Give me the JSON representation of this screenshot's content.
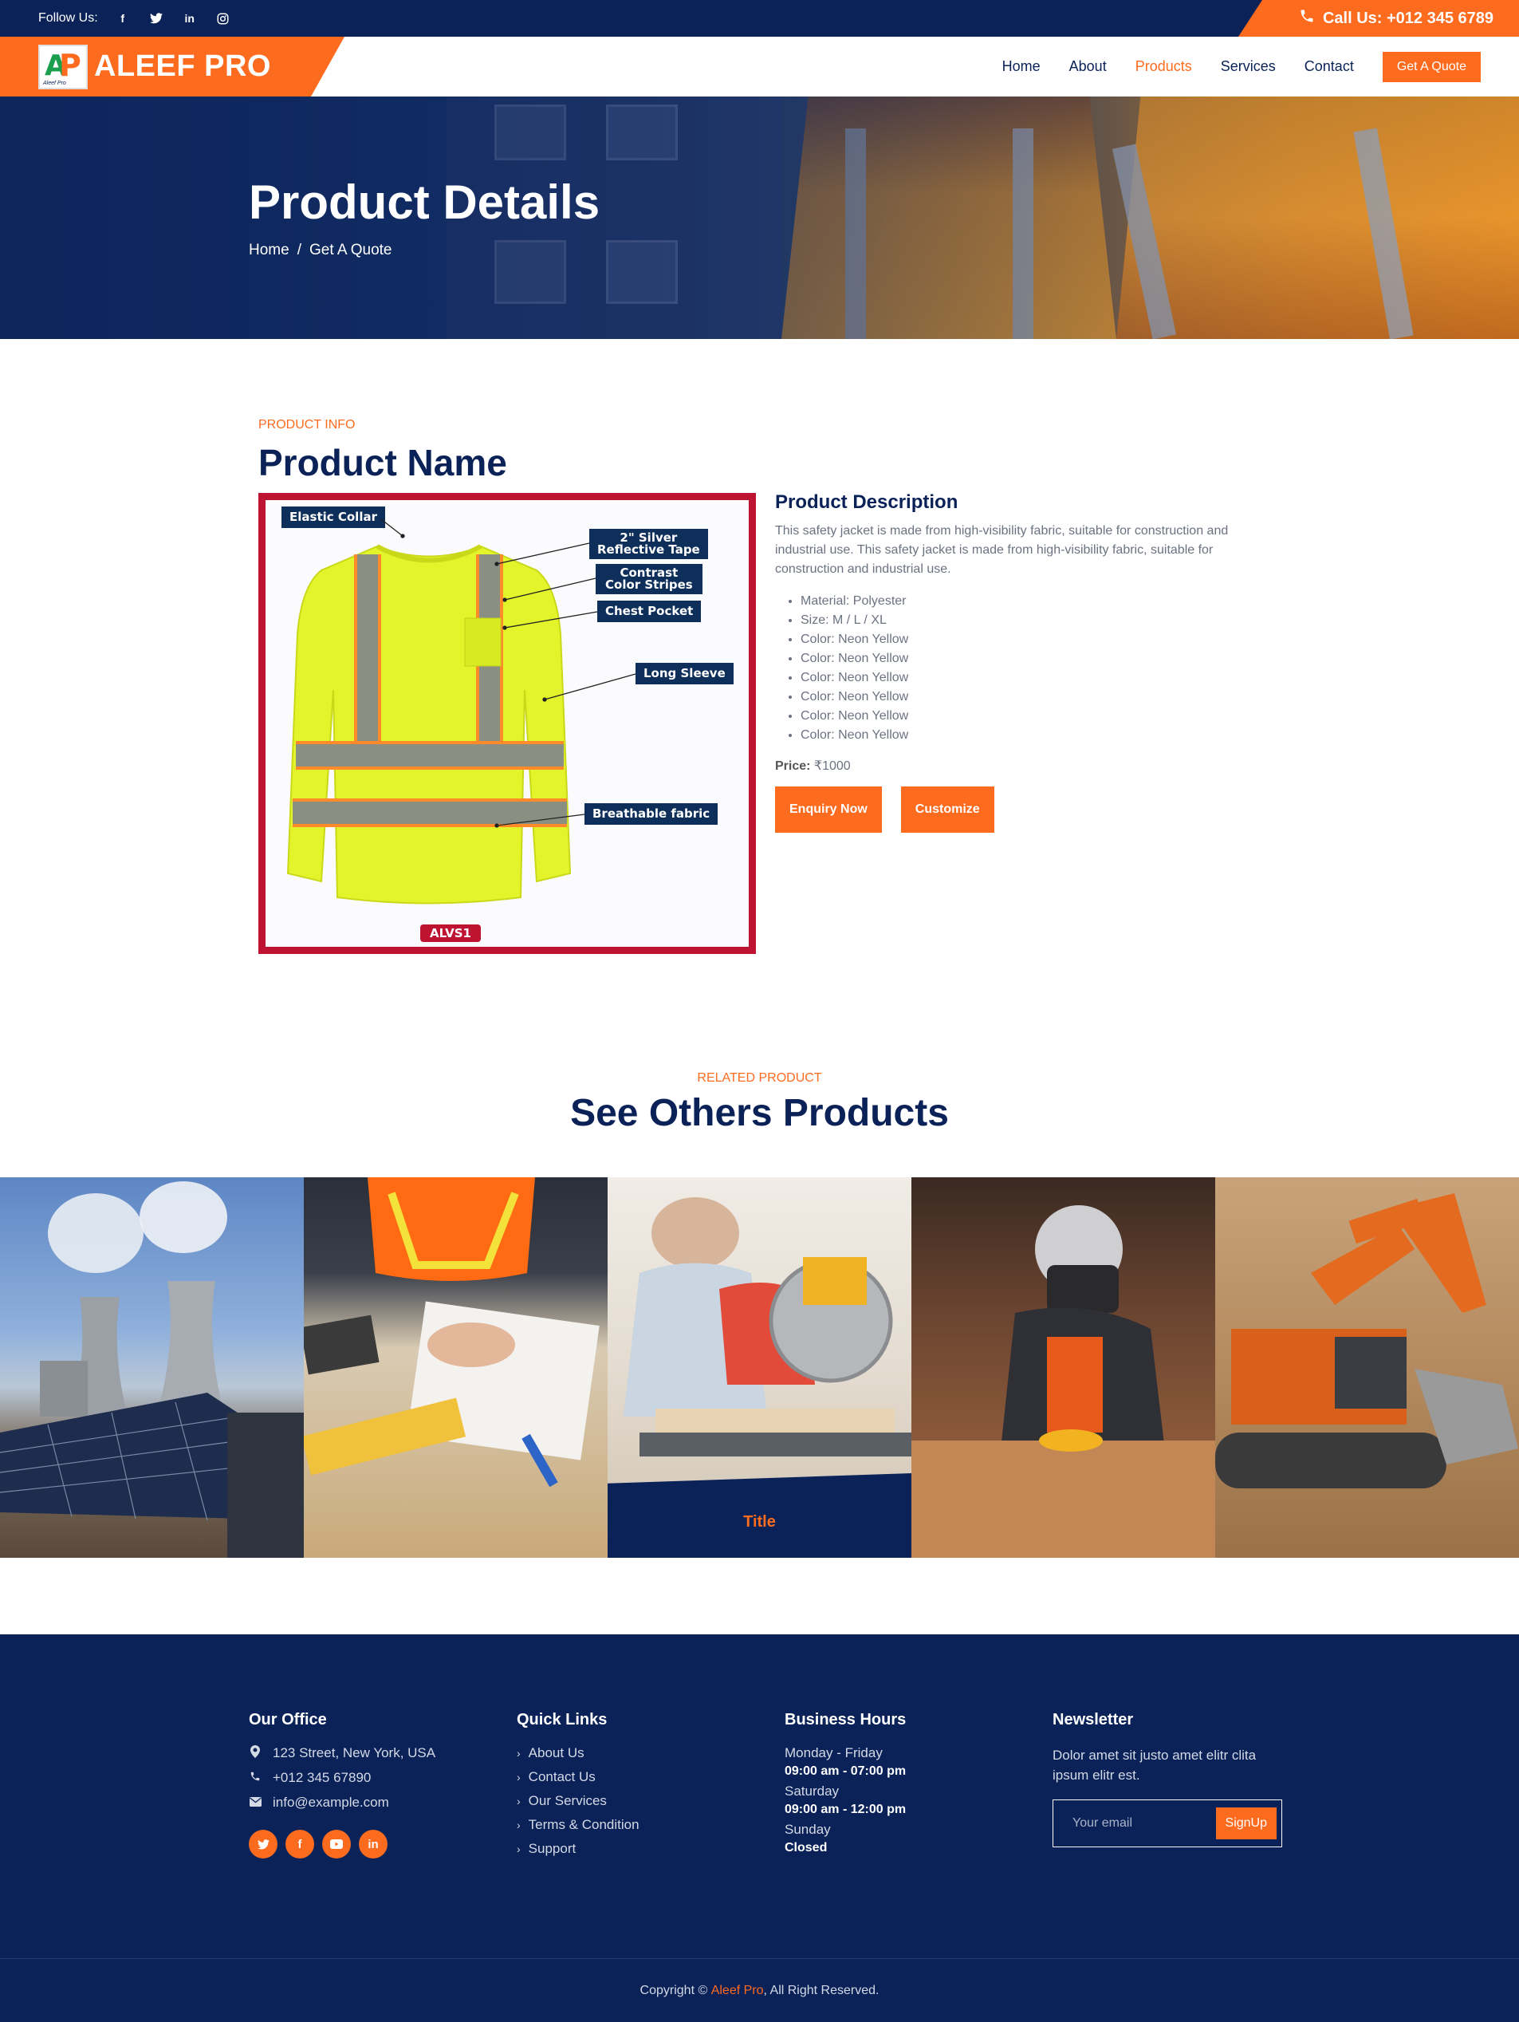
{
  "topbar": {
    "follow_label": "Follow Us:",
    "social_icons": [
      "facebook-icon",
      "twitter-icon",
      "linkedin-icon",
      "instagram-icon"
    ],
    "call_label": "Call Us: +012 345 6789"
  },
  "nav": {
    "brand": "ALEEF PRO",
    "logo_text": "Aleef Pro",
    "menu": [
      {
        "label": "Home",
        "active": false
      },
      {
        "label": "About",
        "active": false
      },
      {
        "label": "Products",
        "active": true
      },
      {
        "label": "Services",
        "active": false
      },
      {
        "label": "Contact",
        "active": false
      }
    ],
    "cta": "Get A Quote"
  },
  "hero": {
    "title": "Product Details",
    "breadcrumb": [
      "Home",
      "/",
      "Get A Quote"
    ]
  },
  "product": {
    "eyebrow": "PRODUCT INFO",
    "name": "Product Name",
    "image_callouts": {
      "elastic_collar": "Elastic Collar",
      "reflective_tape_1": "2\" Silver",
      "reflective_tape_2": "Reflective Tape",
      "contrast_1": "Contrast",
      "contrast_2": "Color Stripes",
      "chest_pocket": "Chest Pocket",
      "long_sleeve": "Long Sleeve",
      "breathable": "Breathable fabric",
      "code": "ALVS1"
    },
    "description_title": "Product Description",
    "description": "This safety jacket is made from high-visibility fabric, suitable for construction and industrial use. This safety jacket is made from high-visibility fabric, suitable for construction and industrial use.",
    "specs": [
      "Material: Polyester",
      "Size: M / L / XL",
      "Color: Neon Yellow",
      "Color: Neon Yellow",
      "Color: Neon Yellow",
      "Color: Neon Yellow",
      "Color: Neon Yellow",
      "Color: Neon Yellow"
    ],
    "price_label": "Price:",
    "price_value": "₹1000",
    "enquiry_btn": "Enquiry Now",
    "customize_btn": "Customize"
  },
  "related": {
    "eyebrow": "RELATED PRODUCT",
    "title": "See Others Products",
    "tile_caption": "Title"
  },
  "footer": {
    "office_title": "Our Office",
    "address": "123 Street, New York, USA",
    "phone": "+012 345 67890",
    "email": "info@example.com",
    "social_icons": [
      "twitter-icon",
      "facebook-icon",
      "youtube-icon",
      "linkedin-icon"
    ],
    "links_title": "Quick Links",
    "links": [
      "About Us",
      "Contact Us",
      "Our Services",
      "Terms & Condition",
      "Support"
    ],
    "hours_title": "Business Hours",
    "hours": [
      {
        "day": "Monday - Friday",
        "time": "09:00 am - 07:00 pm"
      },
      {
        "day": "Saturday",
        "time": "09:00 am - 12:00 pm"
      },
      {
        "day": "Sunday",
        "time": "Closed"
      }
    ],
    "newsletter_title": "Newsletter",
    "newsletter_text": "Dolor amet sit justo amet elitr clita ipsum elitr est.",
    "email_placeholder": "Your email",
    "signup": "SignUp",
    "copyright_pre": "Copyright ©",
    "copyright_brand": "Aleef Pro",
    "copyright_post": ", All Right Reserved."
  },
  "colors": {
    "navy": "#0a2257",
    "orange": "#fd6b1f",
    "frame_red": "#be1431",
    "neon_yellow": "#e3f52a"
  }
}
